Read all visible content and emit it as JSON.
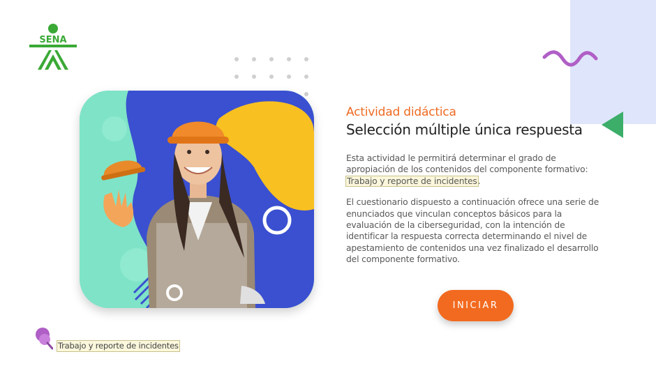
{
  "logo": {
    "text": "SENA",
    "color": "#3aa935"
  },
  "hero": {
    "kicker": "Actividad didáctica",
    "title": "Selección múltiple única respuesta"
  },
  "description": {
    "p1_before": "Esta actividad le permitirá determinar el grado de apropiación de los contenidos del componente formativo: ",
    "p1_highlight": "Trabajo y reporte de incidentes",
    "p1_after": ".",
    "p2": "El cuestionario dispuesto a continuación ofrece una serie de enunciados que vinculan conceptos básicos para la evaluación de la ciberseguridad, con la intención de identificar la respuesta correcta determinando el nivel de apestamiento de contenidos una vez finalizado el desarrollo del componente formativo."
  },
  "start_button": {
    "label": "INICIAR"
  },
  "footer": {
    "component_label": "Trabajo y reporte de incidentes"
  },
  "colors": {
    "accent": "#f26a1f",
    "title": "#222222",
    "brand_green": "#3aa935",
    "deco_purple": "#b05fc6",
    "deco_green": "#3cae6a",
    "deco_blue_bg": "#dfe6fb",
    "card_mint": "#7fe3c7",
    "card_blue": "#3a50d0",
    "card_yellow": "#f8c021"
  },
  "icons": {
    "logo": "sena-logo-icon",
    "footer": "pin-icon",
    "wave": "wave-decoration-icon",
    "triangle": "triangle-decoration-icon"
  }
}
